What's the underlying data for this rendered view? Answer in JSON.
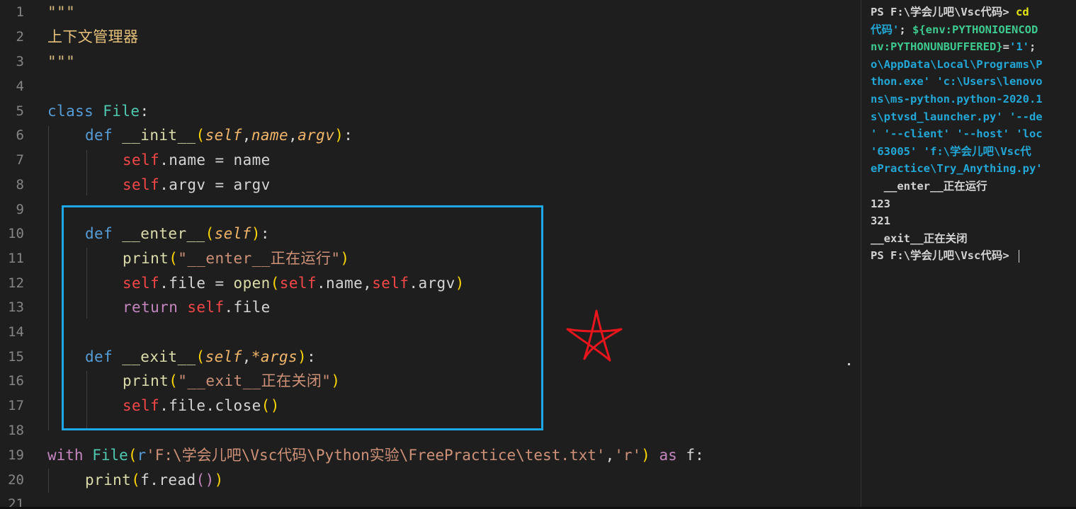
{
  "editor": {
    "line_numbers": [
      "1",
      "2",
      "3",
      "4",
      "5",
      "6",
      "7",
      "8",
      "9",
      "10",
      "11",
      "12",
      "13",
      "14",
      "15",
      "16",
      "17",
      "18",
      "19",
      "20",
      "21"
    ],
    "l1": "\"\"\"",
    "l2": "上下文管理器",
    "l3": "\"\"\"",
    "l5": {
      "kw": "class",
      "name": "File",
      "colon": ":"
    },
    "l6": {
      "kw": "def",
      "name": "__init__",
      "open": "(",
      "self": "self",
      "c1": ",",
      "p1": "name",
      "c2": ",",
      "p2": "argv",
      "close": ")",
      "colon": ":"
    },
    "l7": {
      "self": "self",
      "rest": ".name = name"
    },
    "l8": {
      "self": "self",
      "rest": ".argv = argv"
    },
    "l10": {
      "kw": "def",
      "name": "__enter__",
      "open": "(",
      "self": "self",
      "close": ")",
      "colon": ":"
    },
    "l11": {
      "fn": "print",
      "open": "(",
      "str_q1": "\"",
      "str": "__enter__正在运行",
      "str_q2": "\"",
      "close": ")"
    },
    "l12": {
      "self": "self",
      "mid": ".file = ",
      "fn": "open",
      "open": "(",
      "self2": "self",
      "mid2": ".name,",
      "self3": "self",
      "mid3": ".argv",
      "close": ")"
    },
    "l13": {
      "kw": "return",
      "self": "self",
      "rest": ".file"
    },
    "l15": {
      "kw": "def",
      "name": "__exit__",
      "open": "(",
      "self": "self",
      "c1": ",",
      "p1": "*args",
      "close": ")",
      "colon": ":"
    },
    "l16": {
      "fn": "print",
      "open": "(",
      "str_q1": "\"",
      "str": "__exit__正在关闭",
      "str_q2": "\"",
      "close": ")"
    },
    "l17": {
      "self": "self",
      "rest": ".file.close",
      "call": "()"
    },
    "l19": {
      "kw": "with",
      "cls": "File",
      "open": "(",
      "prefix": "r",
      "str": "'F:\\学会儿吧\\Vsc代码\\Python实验\\FreePractice\\test.txt'",
      "comma": ",",
      "str2": "'r'",
      "close": ")",
      "kw2": "as",
      "var": "f:"
    },
    "l20": {
      "fn": "print",
      "open": "(",
      "mid": "f.read",
      "call": "()",
      "close": ")"
    }
  },
  "terminal": {
    "lines": [
      {
        "t1": "PS F:\\学会儿吧\\Vsc代码> ",
        "t2": "cd"
      },
      {
        "t1": "代码'",
        "t2": "; ",
        "t3": "${env:PYTHONIOENCOD"
      },
      {
        "t1": "nv:PYTHONUNBUFFERED}",
        "t2": "=",
        "t3": "'1'",
        "t4": ";"
      },
      {
        "t1": "o\\AppData\\Local\\Programs\\P"
      },
      {
        "t1": "thon.exe' 'c:\\Users\\lenovo"
      },
      {
        "t1": "ns\\ms-python.python-2020.1"
      },
      {
        "t1": "s\\ptvsd_launcher.py' '--de"
      },
      {
        "t1": "' '--client' '--host' 'loc"
      },
      {
        "t1": "'63005' 'f:\\学会儿吧\\Vsc代"
      },
      {
        "t1": "ePractice\\Try_Anything.py'"
      },
      {
        "t1": "  __enter__正在运行"
      },
      {
        "t1": "123"
      },
      {
        "t1": "321"
      },
      {
        "t1": "__exit__正在关闭"
      },
      {
        "t1": "PS F:\\学会儿吧\\Vsc代码> "
      }
    ]
  },
  "colors": {
    "highlight_box": "#1ea7e6",
    "star_annotation": "#e8151c"
  }
}
